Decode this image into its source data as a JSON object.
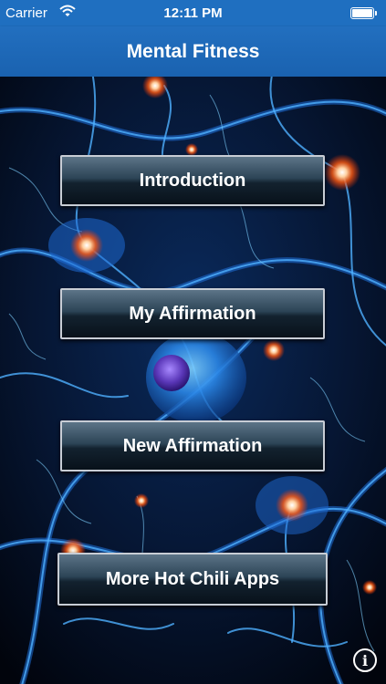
{
  "status_bar": {
    "carrier": "Carrier",
    "time": "12:11 PM",
    "wifi_icon": "wifi-icon",
    "battery_icon": "battery-icon",
    "battery_level": 1.0
  },
  "nav": {
    "title": "Mental Fitness"
  },
  "menu": {
    "introduction": "Introduction",
    "my_affirmation": "My Affirmation",
    "new_affirmation": "New Affirmation",
    "more_apps": "More Hot Chili Apps"
  },
  "info_button": {
    "icon": "info-icon",
    "glyph": "i"
  },
  "colors": {
    "nav_blue": "#1f6fc0",
    "neuron_blue": "#2f8dff",
    "synapse_orange": "#ff6a1a",
    "nucleus_purple": "#6b45c9"
  }
}
